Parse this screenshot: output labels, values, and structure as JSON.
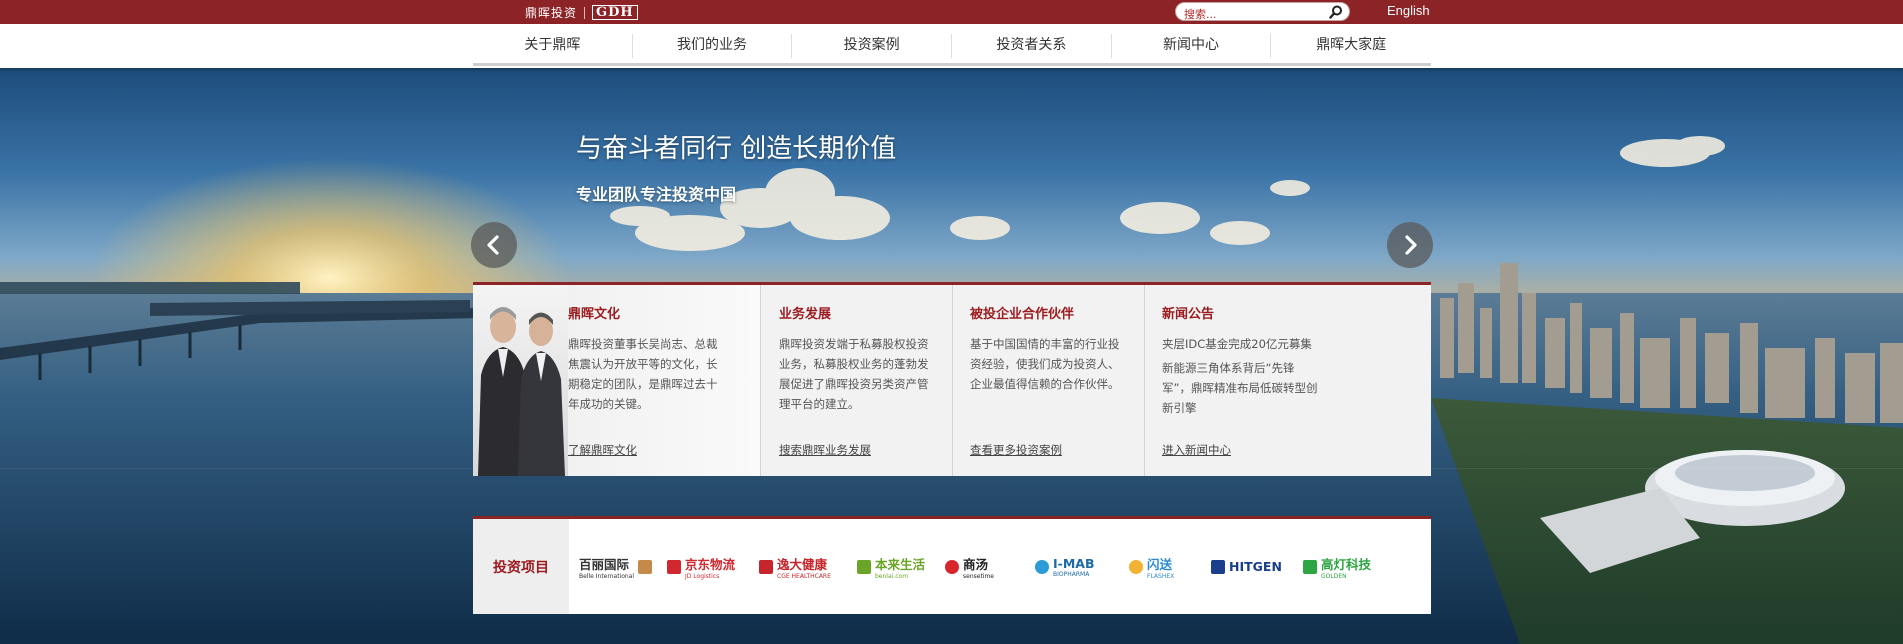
{
  "brand": {
    "name": "鼎晖投资",
    "latin": "GDH"
  },
  "search": {
    "placeholder": "搜索..."
  },
  "language": "English",
  "nav": [
    "关于鼎晖",
    "我们的业务",
    "投资案例",
    "投资者关系",
    "新闻中心",
    "鼎晖大家庭"
  ],
  "hero": {
    "headline": "与奋斗者同行 创造长期价值",
    "subline": "专业团队专注投资中国"
  },
  "cards": [
    {
      "title": "鼎晖文化",
      "paragraphs": [
        "鼎晖投资董事长吴尚志、总裁焦震认为开放平等的文化，长期稳定的团队，是鼎晖过去十年成功的关键。"
      ],
      "link": "了解鼎晖文化"
    },
    {
      "title": "业务发展",
      "paragraphs": [
        "鼎晖投资发端于私募股权投资业务，私募股权业务的蓬勃发展促进了鼎晖投资另类资产管理平台的建立。"
      ],
      "link": "搜索鼎晖业务发展"
    },
    {
      "title": "被投企业合作伙伴",
      "paragraphs": [
        "基于中国国情的丰富的行业投资经验，使我们成为投资人、企业最值得信赖的合作伙伴。"
      ],
      "link": "查看更多投资案例"
    },
    {
      "title": "新闻公告",
      "paragraphs": [
        "夹层IDC基金完成20亿元募集",
        "新能源三角体系背后“先锋军”，鼎晖精准布局低碳转型创新引擎"
      ],
      "link": "进入新闻中心"
    }
  ],
  "portfolio": {
    "title": "投资项目",
    "logos": [
      {
        "name": "百丽国际",
        "sub": "Belle International",
        "color": "#333333",
        "mark": "#c38a4a"
      },
      {
        "name": "京东物流",
        "sub": "JD Logistics",
        "color": "#d0282e",
        "mark": "#d0282e"
      },
      {
        "name": "逸大健康",
        "sub": "CGE HEALTHCARE",
        "color": "#c6262b",
        "mark": "#c6262b"
      },
      {
        "name": "本来生活",
        "sub": "benlai.com",
        "color": "#6aa527",
        "mark": "#6aa527"
      },
      {
        "name": "商汤",
        "sub": "sensetime",
        "color": "#222222",
        "mark": "#d6262b"
      },
      {
        "name": "I-MAB",
        "sub": "BIOPHARMA",
        "color": "#1d6aa8",
        "mark": "#2a9bd6"
      },
      {
        "name": "闪送",
        "sub": "FLASHEX",
        "color": "#2b8ad6",
        "mark": "#f2b233"
      },
      {
        "name": "HITGEN",
        "sub": "",
        "color": "#1a3d8c",
        "mark": "#1a3d8c"
      },
      {
        "name": "高灯科技",
        "sub": "GOLDEN",
        "color": "#2ea543",
        "mark": "#2ea543"
      }
    ]
  },
  "colors": {
    "brand_red": "#8c2327",
    "title_red": "#9b1b1f"
  }
}
